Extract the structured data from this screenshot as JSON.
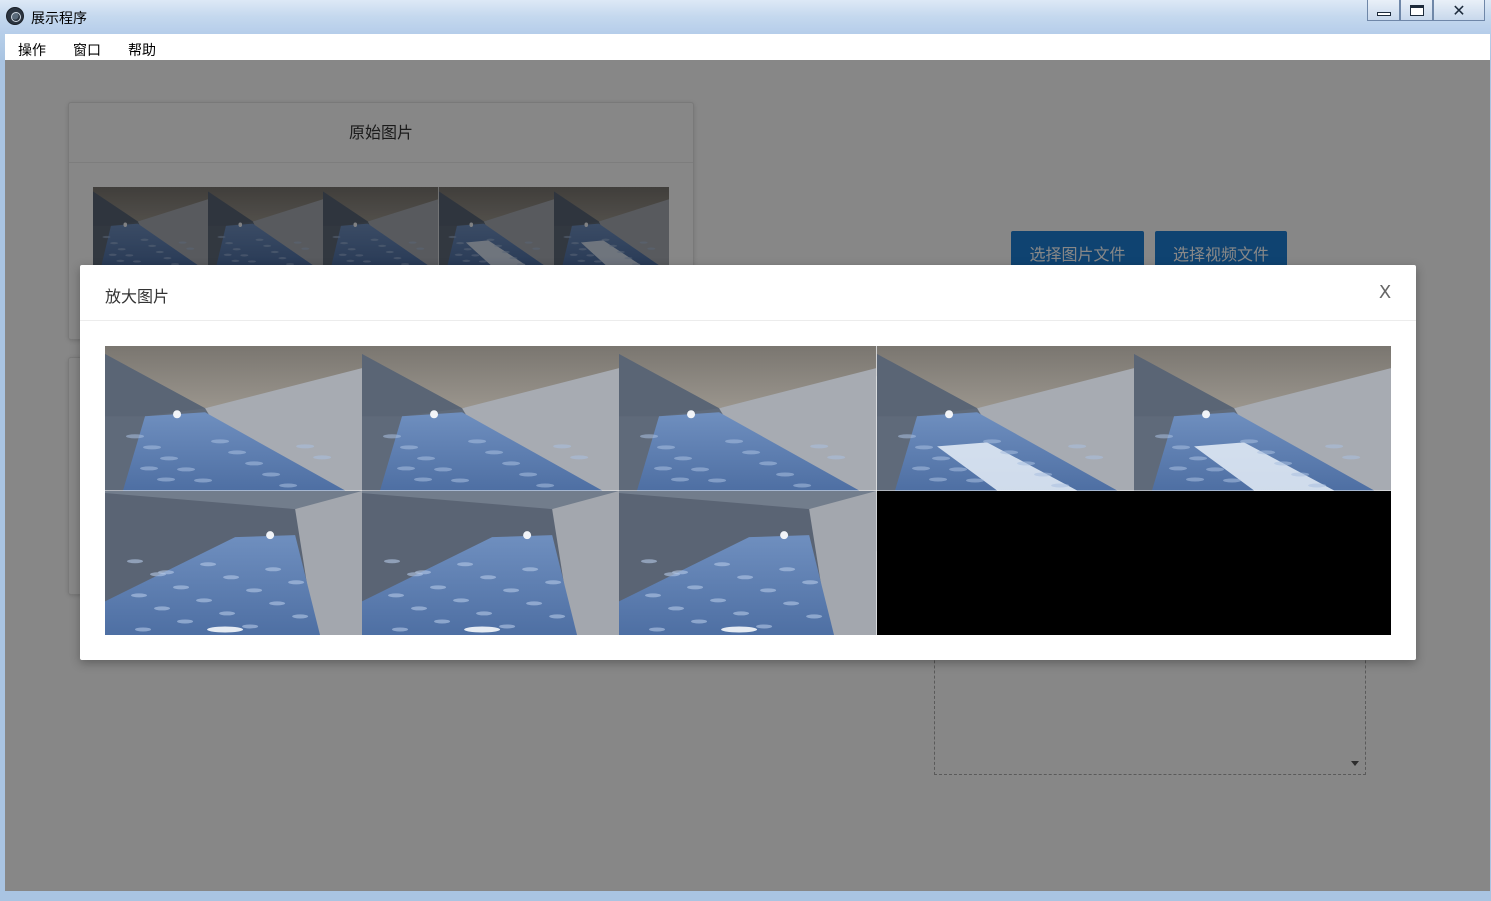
{
  "window": {
    "title": "展示程序",
    "buttons": {
      "minimize": "minimize-icon",
      "maximize": "maximize-icon",
      "close": "close-icon"
    }
  },
  "menu": {
    "items": [
      "操作",
      "窗口",
      "帮助"
    ]
  },
  "page": {
    "original_card_title": "原始图片",
    "select_image_button": "选择图片文件",
    "select_video_button": "选择视频文件",
    "accent_color": "#1e7fd6"
  },
  "modal": {
    "title": "放大图片",
    "close_label": "X",
    "frames": [
      {
        "kind": "far-left",
        "filled": true
      },
      {
        "kind": "far-center",
        "filled": true
      },
      {
        "kind": "far-right",
        "filled": true
      },
      {
        "kind": "bright-right",
        "filled": true
      },
      {
        "kind": "bright-left",
        "filled": true
      },
      {
        "kind": "near-left",
        "filled": true
      },
      {
        "kind": "near-center",
        "filled": true
      },
      {
        "kind": "near-right",
        "filled": true
      },
      {
        "kind": "empty",
        "filled": false
      },
      {
        "kind": "empty",
        "filled": false
      }
    ]
  }
}
